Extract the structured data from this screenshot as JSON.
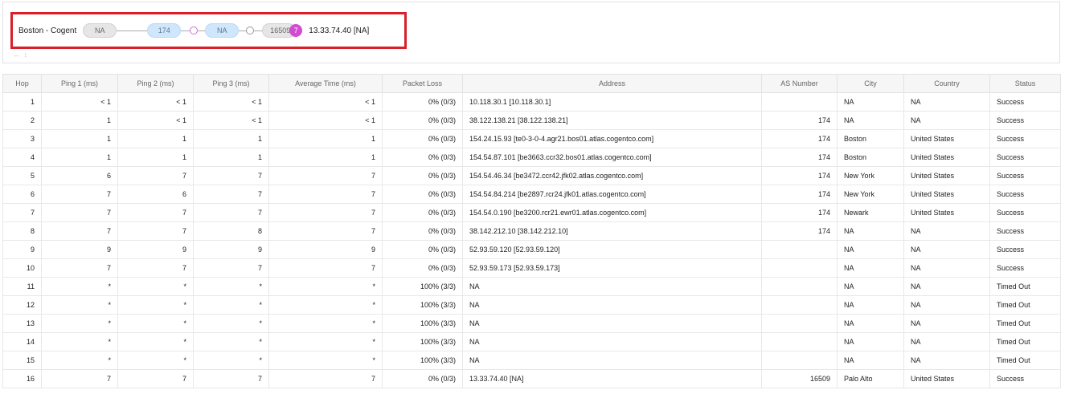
{
  "path": {
    "label": "Boston - Cogent",
    "nodes": [
      "NA",
      "174",
      "NA",
      "16509"
    ],
    "badge": "7",
    "destination": "13.33.74.40 [NA]",
    "expand_icon": "↔ ↕"
  },
  "table": {
    "headers": [
      "Hop",
      "Ping 1 (ms)",
      "Ping 2 (ms)",
      "Ping 3 (ms)",
      "Average Time (ms)",
      "Packet Loss",
      "Address",
      "AS Number",
      "City",
      "Country",
      "Status"
    ],
    "rows": [
      [
        "1",
        "< 1",
        "< 1",
        "< 1",
        "< 1",
        "0% (0/3)",
        "10.118.30.1 [10.118.30.1]",
        "",
        "NA",
        "NA",
        "Success"
      ],
      [
        "2",
        "1",
        "< 1",
        "< 1",
        "< 1",
        "0% (0/3)",
        "38.122.138.21 [38.122.138.21]",
        "174",
        "NA",
        "NA",
        "Success"
      ],
      [
        "3",
        "1",
        "1",
        "1",
        "1",
        "0% (0/3)",
        "154.24.15.93 [te0-3-0-4.agr21.bos01.atlas.cogentco.com]",
        "174",
        "Boston",
        "United States",
        "Success"
      ],
      [
        "4",
        "1",
        "1",
        "1",
        "1",
        "0% (0/3)",
        "154.54.87.101 [be3663.ccr32.bos01.atlas.cogentco.com]",
        "174",
        "Boston",
        "United States",
        "Success"
      ],
      [
        "5",
        "6",
        "7",
        "7",
        "7",
        "0% (0/3)",
        "154.54.46.34 [be3472.ccr42.jfk02.atlas.cogentco.com]",
        "174",
        "New York",
        "United States",
        "Success"
      ],
      [
        "6",
        "7",
        "6",
        "7",
        "7",
        "0% (0/3)",
        "154.54.84.214 [be2897.rcr24.jfk01.atlas.cogentco.com]",
        "174",
        "New York",
        "United States",
        "Success"
      ],
      [
        "7",
        "7",
        "7",
        "7",
        "7",
        "0% (0/3)",
        "154.54.0.190 [be3200.rcr21.ewr01.atlas.cogentco.com]",
        "174",
        "Newark",
        "United States",
        "Success"
      ],
      [
        "8",
        "7",
        "7",
        "8",
        "7",
        "0% (0/3)",
        "38.142.212.10 [38.142.212.10]",
        "174",
        "NA",
        "NA",
        "Success"
      ],
      [
        "9",
        "9",
        "9",
        "9",
        "9",
        "0% (0/3)",
        "52.93.59.120 [52.93.59.120]",
        "",
        "NA",
        "NA",
        "Success"
      ],
      [
        "10",
        "7",
        "7",
        "7",
        "7",
        "0% (0/3)",
        "52.93.59.173 [52.93.59.173]",
        "",
        "NA",
        "NA",
        "Success"
      ],
      [
        "11",
        "*",
        "*",
        "*",
        "*",
        "100% (3/3)",
        "NA",
        "",
        "NA",
        "NA",
        "Timed Out"
      ],
      [
        "12",
        "*",
        "*",
        "*",
        "*",
        "100% (3/3)",
        "NA",
        "",
        "NA",
        "NA",
        "Timed Out"
      ],
      [
        "13",
        "*",
        "*",
        "*",
        "*",
        "100% (3/3)",
        "NA",
        "",
        "NA",
        "NA",
        "Timed Out"
      ],
      [
        "14",
        "*",
        "*",
        "*",
        "*",
        "100% (3/3)",
        "NA",
        "",
        "NA",
        "NA",
        "Timed Out"
      ],
      [
        "15",
        "*",
        "*",
        "*",
        "*",
        "100% (3/3)",
        "NA",
        "",
        "NA",
        "NA",
        "Timed Out"
      ],
      [
        "16",
        "7",
        "7",
        "7",
        "7",
        "0% (0/3)",
        "13.33.74.40 [NA]",
        "16509",
        "Palo Alto",
        "United States",
        "Success"
      ]
    ]
  },
  "colors": {
    "highlight": "#d9202a",
    "node_gray": "#e6e6e6",
    "node_blue": "#cfe6fb",
    "badge": "#d14cd1"
  }
}
